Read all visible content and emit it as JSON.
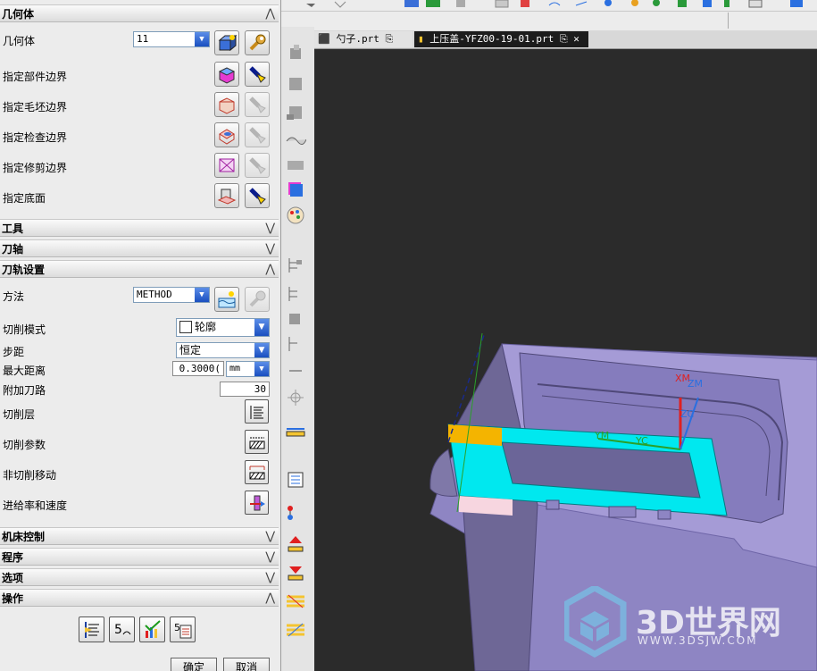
{
  "dialog": {
    "sections": {
      "geometry": "几何体",
      "tools": "工具",
      "tool_axis": "刀轴",
      "path_settings": "刀轨设置",
      "machine_control": "机床控制",
      "program": "程序",
      "options": "选项",
      "actions": "操作"
    },
    "geometry": {
      "label": "几何体",
      "value": "11",
      "rows": [
        "指定部件边界",
        "指定毛坯边界",
        "指定检查边界",
        "指定修剪边界",
        "指定底面"
      ]
    },
    "path": {
      "method_label": "方法",
      "method_value": "METHOD",
      "cut_pattern_label": "切削模式",
      "cut_pattern_value": "轮廓",
      "stepover_label": "步距",
      "stepover_value": "恒定",
      "max_distance_label": "最大距离",
      "max_distance_value": "0.3000(",
      "max_distance_unit": "mm",
      "additional_passes_label": "附加刀路",
      "additional_passes_value": "30",
      "cut_levels_label": "切削层",
      "cut_params_label": "切削参数",
      "non_cut_label": "非切削移动",
      "feeds_label": "进给率和速度"
    },
    "buttons": {
      "ok": "确定",
      "cancel": "取消"
    }
  },
  "tabs": [
    {
      "label": "勺子.prt"
    },
    {
      "label": "上压盖-YFZ00-19-01.prt"
    }
  ],
  "viewport": {
    "triad": {
      "xm": "XM",
      "zm": "ZM",
      "zc": "ZC",
      "ym": "YM",
      "yc": "YC"
    },
    "watermark": {
      "title": "3D世界网",
      "url": "WWW.3DSJW.COM"
    }
  },
  "colors": {
    "part": "#a59bd6",
    "highlight": "#00e8ef",
    "viewport_bg": "#2b2b2b"
  }
}
